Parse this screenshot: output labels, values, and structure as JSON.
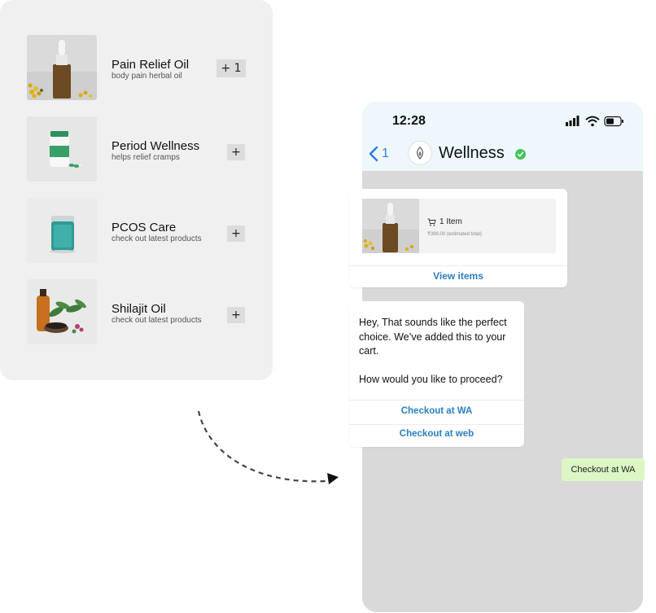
{
  "products": [
    {
      "name": "Pain Relief Oil",
      "desc": "body pain herbal oil",
      "button": "+ 1",
      "image": "amber-dropper-bottle"
    },
    {
      "name": "Period Wellness",
      "desc": "helps relief cramps",
      "button": "+",
      "image": "supplement-jar"
    },
    {
      "name": "PCOS Care",
      "desc": "check out latest products",
      "button": "+",
      "image": "teal-cream-jar"
    },
    {
      "name": "Shilajit Oil",
      "desc": "check out latest products",
      "button": "+",
      "image": "oil-bottle-herbs"
    }
  ],
  "phone": {
    "time": "12:28",
    "back_count": "1",
    "chat_title": "Wellness"
  },
  "cart": {
    "items_label": "1 Item",
    "price_label": "₹399.00 (estimated total)",
    "view_label": "View items"
  },
  "message": {
    "text": "Hey, That sounds like the perfect choice. We’ve added this to your cart.\n\nHow would you like to proceed?",
    "option1": "Checkout at WA",
    "option2": "Checkout at web"
  },
  "sent_message": "Checkout at WA",
  "colors": {
    "accent_blue": "#2a7fbf",
    "ios_blue": "#2f7ce0",
    "verified_green": "#45c45a",
    "sent_bubble": "#dcf7c5"
  }
}
